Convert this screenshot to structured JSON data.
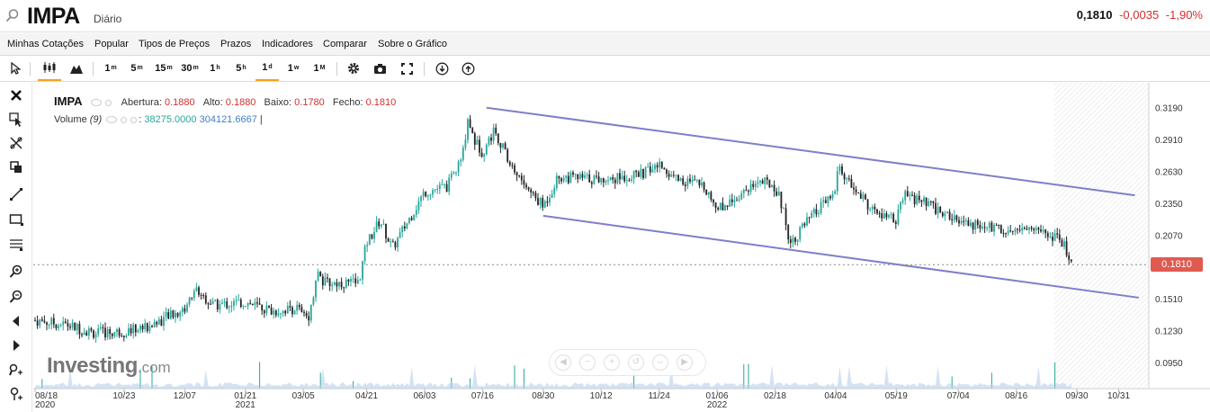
{
  "header": {
    "symbol": "IMPA",
    "period": "Diário",
    "last_price": "0,1810",
    "change": "-0,0035",
    "change_pct": "-1,90%"
  },
  "menu": [
    "Minhas Cotações",
    "Popular",
    "Tipos de Preços",
    "Prazos",
    "Indicadores",
    "Comparar",
    "Sobre o Gráfico"
  ],
  "toolbar": {
    "intervals": [
      {
        "label": "1",
        "sup": "m"
      },
      {
        "label": "5",
        "sup": "m"
      },
      {
        "label": "15",
        "sup": "m"
      },
      {
        "label": "30",
        "sup": "m"
      },
      {
        "label": "1",
        "sup": "h"
      },
      {
        "label": "5",
        "sup": "h"
      },
      {
        "label": "1",
        "sup": "d"
      },
      {
        "label": "1",
        "sup": "w"
      },
      {
        "label": "1",
        "sup": "M"
      }
    ],
    "active_interval": "1d"
  },
  "legend": {
    "name": "IMPA",
    "open_label": "Abertura:",
    "open": "0.1880",
    "high_label": "Alto:",
    "high": "0.1880",
    "low_label": "Baixo:",
    "low": "0.1780",
    "close_label": "Fecho:",
    "close": "0.1810",
    "volume_label": "Volume",
    "volume_param": "(9)",
    "volume_value": "38275.0000",
    "volume_ma": "304121.6667"
  },
  "brand": {
    "name": "Investing",
    "suffix": ".com"
  },
  "price_tag": "0.1810",
  "colors": {
    "up": "#26a69a",
    "down": "#222222",
    "channel": "#7f7fc8",
    "tag": "#e05a4f",
    "active": "#f7a21b"
  },
  "chart_data": {
    "type": "candlestick",
    "y_ticks": [
      "0.3190",
      "0.2910",
      "0.2630",
      "0.2350",
      "0.2070",
      "0.1810",
      "0.1510",
      "0.1230",
      "0.0950"
    ],
    "x_ticks": [
      {
        "label": "08/18",
        "year": "2020"
      },
      {
        "label": "10/23",
        "year": ""
      },
      {
        "label": "12/07",
        "year": ""
      },
      {
        "label": "01/21",
        "year": "2021"
      },
      {
        "label": "03/05",
        "year": ""
      },
      {
        "label": "04/21",
        "year": ""
      },
      {
        "label": "06/03",
        "year": ""
      },
      {
        "label": "07/16",
        "year": ""
      },
      {
        "label": "08/30",
        "year": ""
      },
      {
        "label": "10/12",
        "year": ""
      },
      {
        "label": "11/24",
        "year": ""
      },
      {
        "label": "01/06",
        "year": "2022"
      },
      {
        "label": "02/18",
        "year": ""
      },
      {
        "label": "04/04",
        "year": ""
      },
      {
        "label": "05/19",
        "year": ""
      },
      {
        "label": "07/04",
        "year": ""
      },
      {
        "label": "08/16",
        "year": ""
      },
      {
        "label": "09/30",
        "year": ""
      },
      {
        "label": "10/31",
        "year": ""
      }
    ],
    "close_path": [
      [
        "2020-08-18",
        0.132
      ],
      [
        "2020-09-10",
        0.128
      ],
      [
        "2020-10-01",
        0.121
      ],
      [
        "2020-10-23",
        0.122
      ],
      [
        "2020-11-10",
        0.127
      ],
      [
        "2020-12-07",
        0.142
      ],
      [
        "2020-12-15",
        0.16
      ],
      [
        "2020-12-28",
        0.145
      ],
      [
        "2021-01-21",
        0.148
      ],
      [
        "2021-02-10",
        0.14
      ],
      [
        "2021-03-01",
        0.143
      ],
      [
        "2021-03-05",
        0.135
      ],
      [
        "2021-03-10",
        0.137
      ],
      [
        "2021-03-15",
        0.175
      ],
      [
        "2021-03-20",
        0.165
      ],
      [
        "2021-04-15",
        0.165
      ],
      [
        "2021-04-21",
        0.2
      ],
      [
        "2021-05-01",
        0.22
      ],
      [
        "2021-05-10",
        0.195
      ],
      [
        "2021-06-03",
        0.245
      ],
      [
        "2021-06-20",
        0.25
      ],
      [
        "2021-07-01",
        0.275
      ],
      [
        "2021-07-05",
        0.31
      ],
      [
        "2021-07-10",
        0.29
      ],
      [
        "2021-07-16",
        0.28
      ],
      [
        "2021-07-25",
        0.3
      ],
      [
        "2021-08-05",
        0.27
      ],
      [
        "2021-08-20",
        0.245
      ],
      [
        "2021-08-30",
        0.232
      ],
      [
        "2021-09-10",
        0.258
      ],
      [
        "2021-10-12",
        0.256
      ],
      [
        "2021-11-10",
        0.26
      ],
      [
        "2021-11-24",
        0.268
      ],
      [
        "2021-12-10",
        0.255
      ],
      [
        "2021-12-28",
        0.25
      ],
      [
        "2022-01-06",
        0.23
      ],
      [
        "2022-01-20",
        0.24
      ],
      [
        "2022-02-05",
        0.255
      ],
      [
        "2022-02-18",
        0.25
      ],
      [
        "2022-02-24",
        0.23
      ],
      [
        "2022-03-01",
        0.2
      ],
      [
        "2022-03-15",
        0.22
      ],
      [
        "2022-04-04",
        0.245
      ],
      [
        "2022-04-06",
        0.268
      ],
      [
        "2022-04-15",
        0.25
      ],
      [
        "2022-05-05",
        0.225
      ],
      [
        "2022-05-19",
        0.22
      ],
      [
        "2022-05-25",
        0.242
      ],
      [
        "2022-06-10",
        0.235
      ],
      [
        "2022-07-04",
        0.218
      ],
      [
        "2022-07-20",
        0.215
      ],
      [
        "2022-08-16",
        0.212
      ],
      [
        "2022-09-05",
        0.212
      ],
      [
        "2022-09-20",
        0.2
      ],
      [
        "2022-09-26",
        0.181
      ]
    ],
    "channel_lines": [
      {
        "from": [
          "2021-07-19",
          0.319
        ],
        "to": [
          "2022-11-12",
          0.242
        ]
      },
      {
        "from": [
          "2021-08-30",
          0.224
        ],
        "to": [
          "2022-11-15",
          0.152
        ]
      }
    ],
    "last_price_line": 0.181,
    "ylim": [
      0.08,
      0.333
    ]
  }
}
